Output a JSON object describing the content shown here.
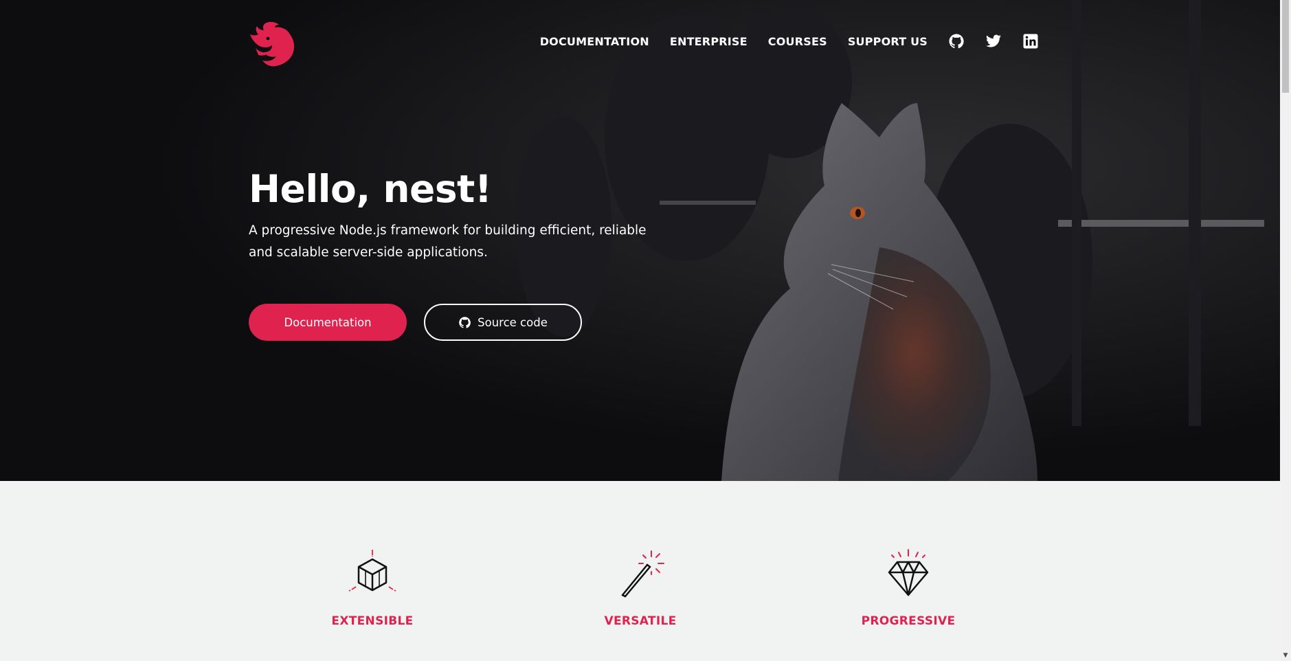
{
  "nav": {
    "links": [
      "DOCUMENTATION",
      "ENTERPRISE",
      "COURSES",
      "SUPPORT US"
    ],
    "icons": [
      "github-icon",
      "twitter-icon",
      "linkedin-icon"
    ]
  },
  "hero": {
    "title": "Hello, nest!",
    "subtitle": "A progressive Node.js framework for building efficient, reliable and scalable server-side applications.",
    "primary_button": "Documentation",
    "secondary_button": "Source code"
  },
  "features": [
    {
      "title": "EXTENSIBLE",
      "icon": "cube-icon"
    },
    {
      "title": "VERSATILE",
      "icon": "magic-wand-icon"
    },
    {
      "title": "PROGRESSIVE",
      "icon": "diamond-icon"
    }
  ],
  "colors": {
    "brand": "#e0234e",
    "hero_background": "#0d0d10",
    "section_background": "#f1f2f2"
  }
}
